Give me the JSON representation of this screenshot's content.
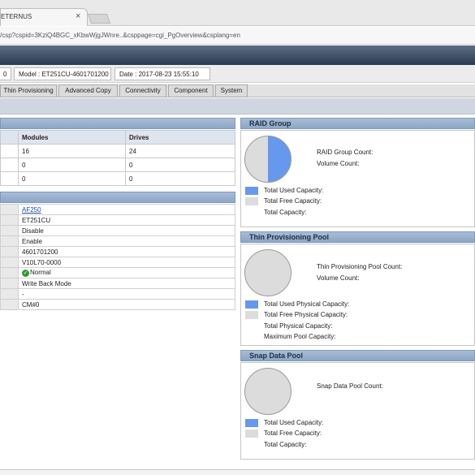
{
  "browser": {
    "tab_title": "ETERNUS",
    "tab_close": "×",
    "url": "/csp?cspid=3KziQ4BGC_xKbwWjgJWnre..&csppage=cgi_PgOverview&csplang=en"
  },
  "info": {
    "item0": "0",
    "model": "Model : ET251CU-4601701200",
    "date": "Date : 2017-08-23 15:55:10"
  },
  "menu": [
    "Thin Provisioning",
    "Advanced Copy",
    "Connectivity",
    "Component",
    "System"
  ],
  "table": {
    "headers": [
      "Modules",
      "Drives"
    ],
    "rows": [
      [
        "16",
        "24"
      ],
      [
        "0",
        "0"
      ],
      [
        "0",
        "0"
      ]
    ]
  },
  "props": [
    "AF250",
    "ET251CU",
    "Disable",
    "Enable",
    "4601701200",
    "V10L70-0000",
    "Normal",
    "Write Back Mode",
    "-",
    "CM#0"
  ],
  "raid": {
    "title": "RAID Group",
    "count_label": "RAID Group Count:",
    "volume_label": "Volume Count:",
    "used_label": "Total Used Capacity:",
    "free_label": "Total Free Capacity:",
    "total_label": "Total Capacity:",
    "used_fraction": 0.5
  },
  "tpp": {
    "title": "Thin Provisioning Pool",
    "count_label": "Thin Provisioning Pool Count:",
    "volume_label": "Volume Count:",
    "used_label": "Total Used Physical Capacity:",
    "free_label": "Total Free Physical Capacity:",
    "total_label": "Total Physical Capacity:",
    "max_label": "Maximum Pool Capacity:"
  },
  "snap": {
    "title": "Snap Data Pool",
    "count_label": "Snap Data Pool Count:",
    "used_label": "Total Used Capacity:",
    "free_label": "Total Free Capacity:",
    "total_label": "Total Capacity:"
  },
  "colors": {
    "used": "#6699ee",
    "free": "#dcdcdc",
    "header": "#8ca6c6"
  }
}
